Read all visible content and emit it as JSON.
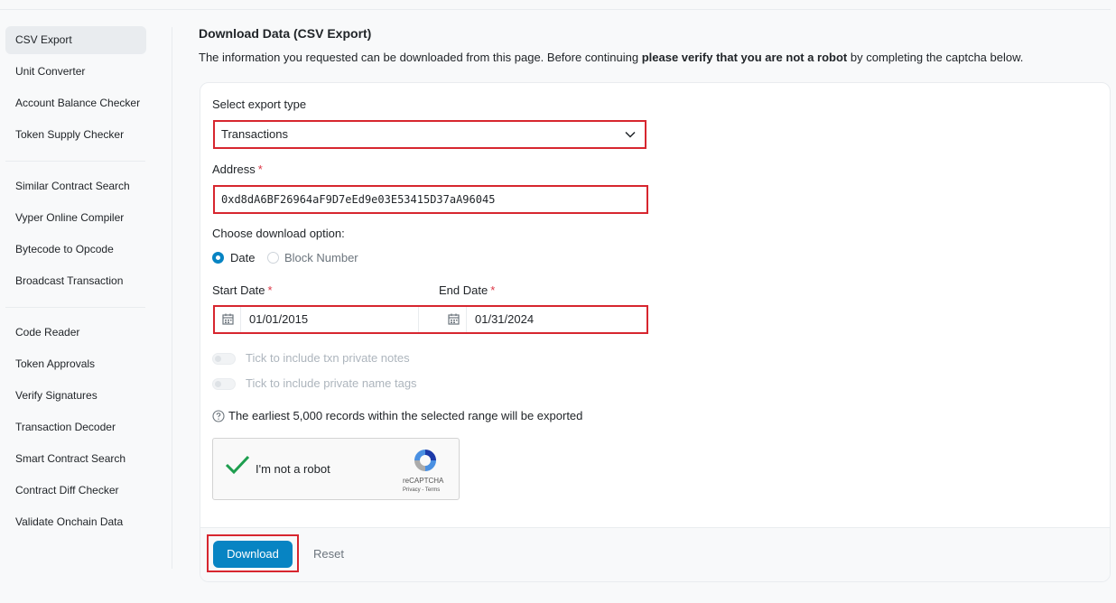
{
  "sidebar": {
    "groups": [
      [
        "CSV Export",
        "Unit Converter",
        "Account Balance Checker",
        "Token Supply Checker"
      ],
      [
        "Similar Contract Search",
        "Vyper Online Compiler",
        "Bytecode to Opcode",
        "Broadcast Transaction"
      ],
      [
        "Code Reader",
        "Token Approvals",
        "Verify Signatures",
        "Transaction Decoder",
        "Smart Contract Search",
        "Contract Diff Checker",
        "Validate Onchain Data"
      ]
    ],
    "active": "CSV Export"
  },
  "header": {
    "title": "Download Data (CSV Export)",
    "desc_before": "The information you requested can be downloaded from this page. Before continuing ",
    "desc_bold": "please verify that you are not a robot",
    "desc_after": " by completing the captcha below."
  },
  "form": {
    "export_type_label": "Select export type",
    "export_type_value": "Transactions",
    "address_label": "Address",
    "address_value": "0xd8dA6BF26964aF9D7eEd9e03E53415D37aA96045",
    "required_mark": "*",
    "download_option_label": "Choose download option:",
    "option_date": "Date",
    "option_block": "Block Number",
    "selected_option": "Date",
    "start_date_label": "Start Date",
    "start_date_value": "01/01/2015",
    "end_date_label": "End Date",
    "end_date_value": "01/31/2024",
    "toggle_notes": "Tick to include txn private notes",
    "toggle_tags": "Tick to include private name tags",
    "info_text": "The earliest 5,000 records within the selected range will be exported"
  },
  "captcha": {
    "label": "I'm not a robot",
    "brand": "reCAPTCHA",
    "links": "Privacy - Terms",
    "checked": true
  },
  "footer": {
    "download_label": "Download",
    "reset_label": "Reset"
  },
  "colors": {
    "primary": "#0784c3",
    "highlight": "#d7262f",
    "required": "#dc3545",
    "check": "#1e9e4f"
  }
}
